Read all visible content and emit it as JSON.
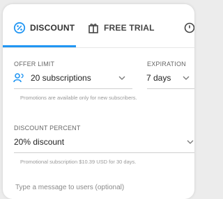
{
  "tabs": [
    {
      "label": "DISCOUNT",
      "icon": "discount-badge-icon",
      "active": true
    },
    {
      "label": "FREE TRIAL",
      "icon": "gift-box-icon",
      "active": false
    }
  ],
  "offer_limit": {
    "label": "OFFER LIMIT",
    "value": "20 subscriptions",
    "icon": "people-icon"
  },
  "expiration": {
    "label": "EXPIRATION",
    "value": "7 days"
  },
  "offer_limit_helper": "Promotions are available only for new subscribers.",
  "discount_percent": {
    "label": "DISCOUNT PERCENT",
    "value": "20% discount",
    "helper": "Promotional subscription $10.39 USD for 30 days."
  },
  "message": {
    "placeholder": "Type a message to users (optional)"
  },
  "colors": {
    "accent": "#2196f3",
    "text": "#1f1f1f",
    "helper": "#999999"
  }
}
